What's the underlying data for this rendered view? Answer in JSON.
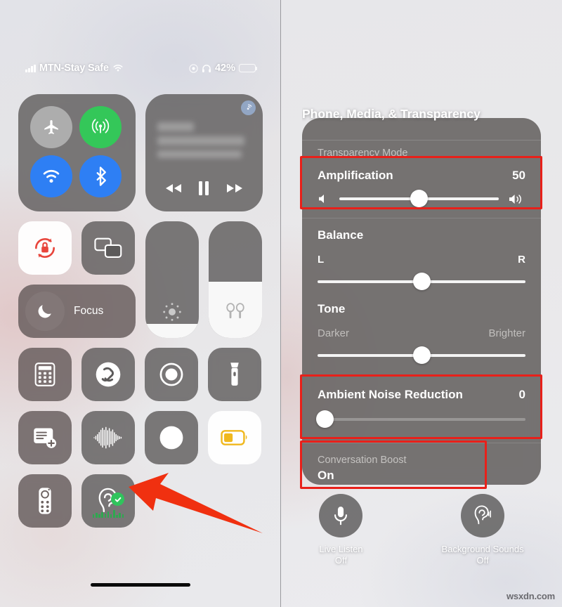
{
  "left": {
    "status_bar": {
      "carrier": "MTN-Stay Safe",
      "signal_icon": "cellular-bars-icon",
      "wifi_icon": "wifi-icon",
      "record_icon": "screen-record-indicator-icon",
      "headphones_icon": "headphones-icon",
      "battery_percent": "42%",
      "battery_icon": "battery-low-power-icon"
    },
    "connectivity": {
      "airplane": {
        "name": "airplane-mode",
        "icon": "airplane-icon",
        "state": "off"
      },
      "cellular": {
        "name": "cellular-data",
        "icon": "cellular-signal-icon",
        "state": "on"
      },
      "wifi": {
        "name": "wifi",
        "icon": "wifi-icon",
        "state": "on"
      },
      "bluetooth": {
        "name": "bluetooth",
        "icon": "bluetooth-icon",
        "state": "on"
      }
    },
    "media": {
      "airplay_icon": "airplay-audio-icon",
      "rewind_icon": "rewind-icon",
      "pause_icon": "pause-icon",
      "forward_icon": "fast-forward-icon"
    },
    "rotation_lock": {
      "icon": "rotation-lock-icon",
      "state": "on"
    },
    "screen_mirroring": {
      "icon": "screen-mirroring-icon",
      "state": "off"
    },
    "focus": {
      "label": "Focus",
      "icon": "moon-icon"
    },
    "brightness": {
      "icon": "brightness-icon",
      "level_percent": 12
    },
    "volume": {
      "icon": "airpods-icon",
      "level_percent": 48
    },
    "icons_row1": [
      {
        "label": "Calculator",
        "icon": "calculator-icon"
      },
      {
        "label": "Shazam",
        "icon": "shazam-icon"
      },
      {
        "label": "Screen Recording",
        "icon": "screen-record-icon"
      },
      {
        "label": "Flashlight",
        "icon": "flashlight-icon"
      }
    ],
    "icons_row2": [
      {
        "label": "Quick Note",
        "icon": "quick-note-icon"
      },
      {
        "label": "Sound Recognition",
        "icon": "sound-recognition-icon"
      },
      {
        "label": "Dark Mode",
        "icon": "dark-mode-icon"
      },
      {
        "label": "Low Power Mode",
        "icon": "low-power-battery-icon",
        "state": "on"
      }
    ],
    "icons_row3": [
      {
        "label": "Apple TV Remote",
        "icon": "remote-icon"
      },
      {
        "label": "Hearing",
        "icon": "hearing-ear-icon",
        "state": "on",
        "badge": "check-badge-icon"
      }
    ],
    "annotation": {
      "arrow": "red-arrow-pointing-to-hearing-tile"
    }
  },
  "right": {
    "sheet_title": "Phone, Media, & Transparency",
    "transparency_mode_label": "Transparency Mode",
    "amplification": {
      "label": "Amplification",
      "value": "50",
      "percent": 50,
      "min_icon": "speaker-low-icon",
      "max_icon": "speaker-high-icon"
    },
    "balance": {
      "label": "Balance",
      "left": "L",
      "right": "R",
      "percent": 50
    },
    "tone": {
      "label": "Tone",
      "left": "Darker",
      "right": "Brighter",
      "percent": 50
    },
    "ambient_noise_reduction": {
      "label": "Ambient Noise Reduction",
      "value": "0",
      "percent": 0
    },
    "conversation_boost": {
      "label": "Conversation Boost",
      "value": "On"
    },
    "buttons": [
      {
        "label": "Live Listen",
        "status": "Off",
        "icon": "microphone-icon"
      },
      {
        "label": "Background Sounds",
        "status": "Off",
        "icon": "hearing-ear-icon"
      }
    ],
    "highlight_color": "#e8201a"
  },
  "watermark": "wsxdn.com"
}
